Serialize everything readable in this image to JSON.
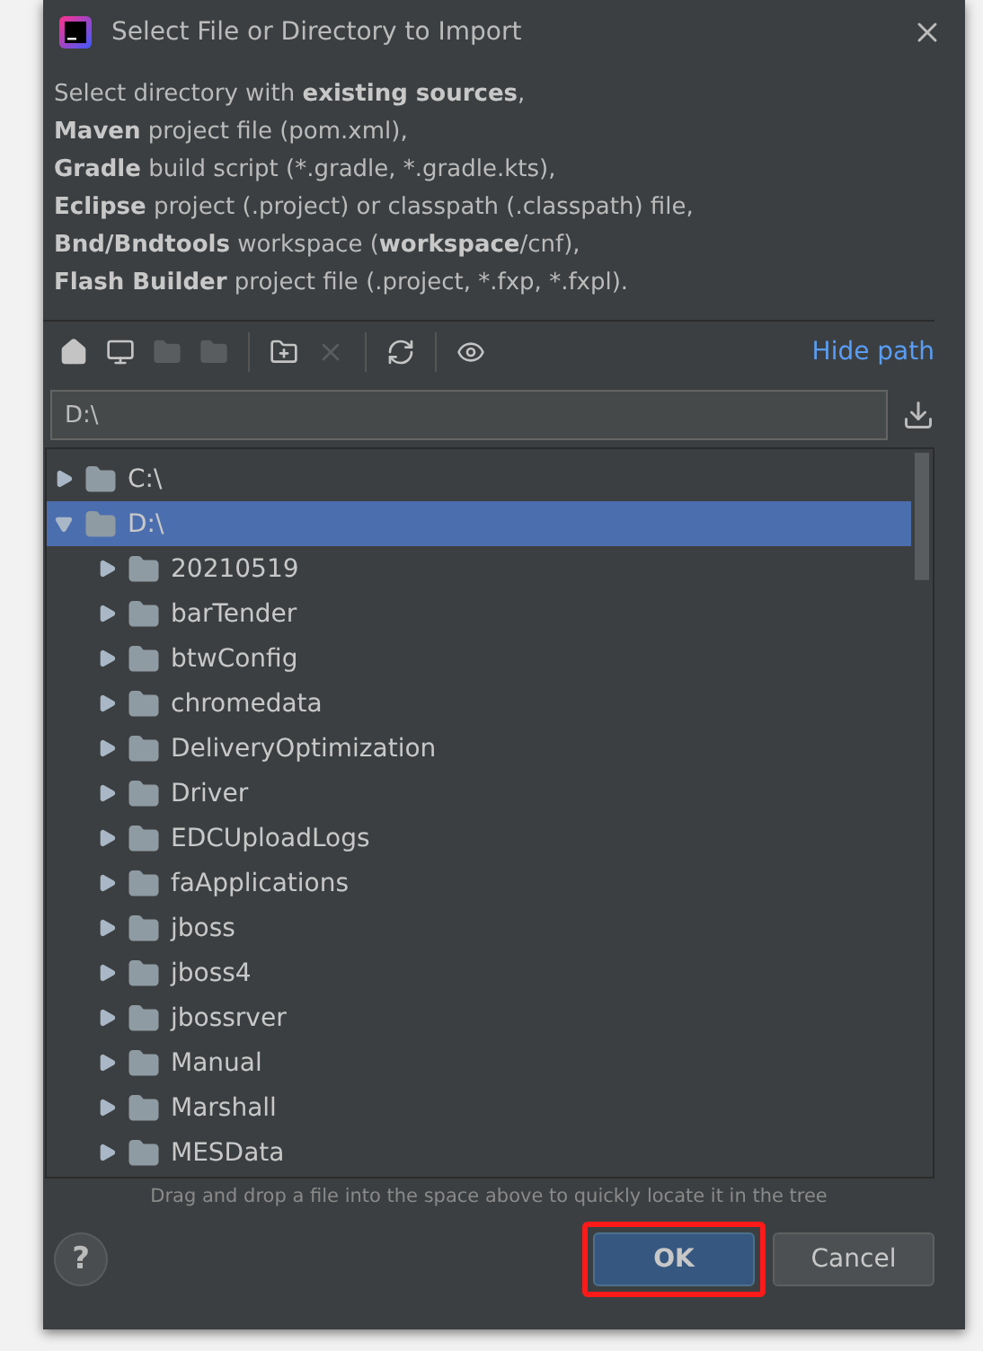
{
  "window": {
    "title": "Select File or Directory to Import"
  },
  "description": [
    "Select directory with **existing sources**,",
    "**Maven** project file (pom.xml),",
    "**Gradle** build script (*.gradle, *.gradle.kts),",
    "**Eclipse** project (.project) or classpath (.classpath) file,",
    "**Bnd/Bndtools** workspace (**workspace**/cnf),",
    "**Flash Builder** project file (.project, *.fxp, *.fxpl)."
  ],
  "toolbar": [
    {
      "kind": "home",
      "disabled": false
    },
    {
      "kind": "desktop",
      "disabled": false
    },
    {
      "kind": "folder",
      "disabled": true
    },
    {
      "kind": "folder",
      "disabled": true
    },
    {
      "kind": "new-folder",
      "disabled": false
    },
    {
      "kind": "delete",
      "disabled": true
    },
    {
      "kind": "refresh",
      "disabled": false
    },
    {
      "kind": "show-hidden",
      "disabled": false
    }
  ],
  "hide_path_link": "Hide path",
  "path_field": {
    "value": "D:\\"
  },
  "tree": [
    {
      "label": "C:\\",
      "expanded": false,
      "selected": false
    },
    {
      "label": "D:\\",
      "expanded": true,
      "selected": true,
      "children": [
        {
          "label": "20210519",
          "expanded": false,
          "selected": false
        },
        {
          "label": "barTender",
          "expanded": false,
          "selected": false
        },
        {
          "label": "btwConfig",
          "expanded": false,
          "selected": false
        },
        {
          "label": "chromedata",
          "expanded": false,
          "selected": false
        },
        {
          "label": "DeliveryOptimization",
          "expanded": false,
          "selected": false
        },
        {
          "label": "Driver",
          "expanded": false,
          "selected": false
        },
        {
          "label": "EDCUploadLogs",
          "expanded": false,
          "selected": false
        },
        {
          "label": "faApplications",
          "expanded": false,
          "selected": false
        },
        {
          "label": "jboss",
          "expanded": false,
          "selected": false
        },
        {
          "label": "jboss4",
          "expanded": false,
          "selected": false
        },
        {
          "label": "jbossrver",
          "expanded": false,
          "selected": false
        },
        {
          "label": "Manual",
          "expanded": false,
          "selected": false
        },
        {
          "label": "Marshall",
          "expanded": false,
          "selected": false
        },
        {
          "label": "MESData",
          "expanded": false,
          "selected": false
        }
      ]
    }
  ],
  "hint": "Drag and drop a file into the space above to quickly locate it in the tree",
  "help_button": "?",
  "buttons": [
    {
      "label": "OK",
      "default": true,
      "highlighted": true
    },
    {
      "label": "Cancel",
      "default": false,
      "highlighted": false
    }
  ]
}
